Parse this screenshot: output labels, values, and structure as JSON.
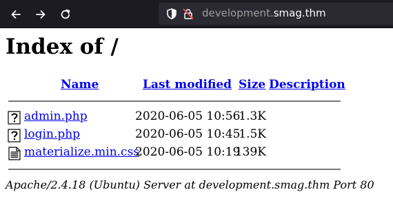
{
  "browser": {
    "url_subdomain": "development.",
    "url_domain": "smag.thm",
    "toolbar_color": "#1c1b22"
  },
  "page": {
    "title": "Index of /",
    "columns": {
      "name": "Name",
      "last_modified": "Last modified",
      "size": "Size",
      "description": "Description"
    },
    "files": [
      {
        "name": "admin.php",
        "modified": "2020-06-05 10:56",
        "size": "1.3K",
        "description": "",
        "icon": "unknown-file-icon"
      },
      {
        "name": "login.php",
        "modified": "2020-06-05 10:45",
        "size": "1.5K",
        "description": "",
        "icon": "unknown-file-icon"
      },
      {
        "name": "materialize.min.css",
        "modified": "2020-06-05 10:19",
        "size": "139K",
        "description": "",
        "icon": "text-file-icon"
      }
    ],
    "footer": "Apache/2.4.18 (Ubuntu) Server at development.smag.thm Port 80"
  }
}
